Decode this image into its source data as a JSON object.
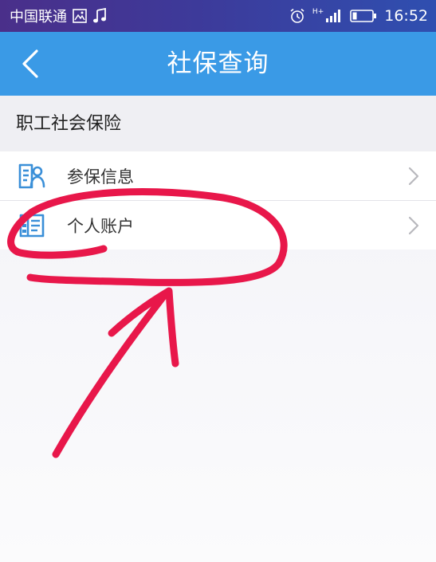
{
  "status_bar": {
    "carrier": "中国联通",
    "network_type": "H+",
    "time": "16:52"
  },
  "nav": {
    "title": "社保查询"
  },
  "section": {
    "title": "职工社会保险"
  },
  "items": [
    {
      "label": "参保信息",
      "icon": "insured-person-icon"
    },
    {
      "label": "个人账户",
      "icon": "account-book-icon"
    }
  ],
  "colors": {
    "nav_blue": "#3a9ae6",
    "icon_blue": "#3a8fd8",
    "annotation_red": "#e8174a"
  }
}
